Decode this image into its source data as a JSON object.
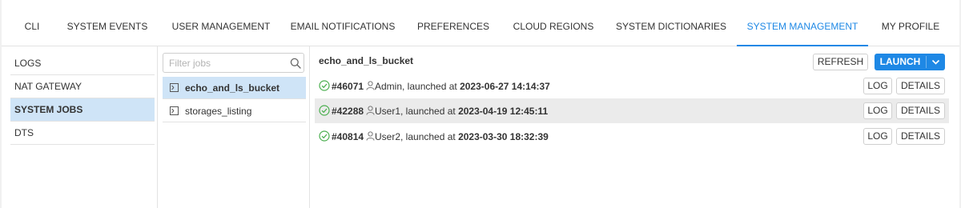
{
  "tabs": [
    {
      "label": "CLI",
      "active": false
    },
    {
      "label": "SYSTEM EVENTS",
      "active": false
    },
    {
      "label": "USER MANAGEMENT",
      "active": false
    },
    {
      "label": "EMAIL NOTIFICATIONS",
      "active": false
    },
    {
      "label": "PREFERENCES",
      "active": false
    },
    {
      "label": "CLOUD REGIONS",
      "active": false
    },
    {
      "label": "SYSTEM DICTIONARIES",
      "active": false
    },
    {
      "label": "SYSTEM MANAGEMENT",
      "active": true
    },
    {
      "label": "MY PROFILE",
      "active": false
    }
  ],
  "sidebar": {
    "items": [
      {
        "label": "LOGS",
        "active": false
      },
      {
        "label": "NAT GATEWAY",
        "active": false
      },
      {
        "label": "SYSTEM JOBS",
        "active": true
      },
      {
        "label": "DTS",
        "active": false
      }
    ]
  },
  "jobs": {
    "filter_placeholder": "Filter jobs",
    "items": [
      {
        "name": "echo_and_ls_bucket",
        "active": true
      },
      {
        "name": "storages_listing",
        "active": false
      }
    ]
  },
  "detail": {
    "title": "echo_and_ls_bucket",
    "refresh_label": "REFRESH",
    "launch_label": "LAUNCH",
    "log_label": "LOG",
    "details_label": "DETAILS",
    "runs": [
      {
        "id": "#46071",
        "user_text": "Admin, launched at ",
        "time": "2023-06-27 14:14:37",
        "status": "success"
      },
      {
        "id": "#42288",
        "user_text": "User1, launched at ",
        "time": "2023-04-19 12:45:11",
        "status": "success"
      },
      {
        "id": "#40814",
        "user_text": "User2, launched at ",
        "time": "2023-03-30 18:32:39",
        "status": "success"
      }
    ]
  },
  "colors": {
    "accent": "#1e88e5",
    "selected_bg": "#cfe4f7",
    "success": "#4caf50",
    "row_shade": "#ebebeb"
  },
  "icons": {
    "search": "search-icon",
    "job": "job-file-icon",
    "status": "check-circle-icon",
    "user": "user-icon",
    "dropdown": "chevron-down-icon"
  }
}
